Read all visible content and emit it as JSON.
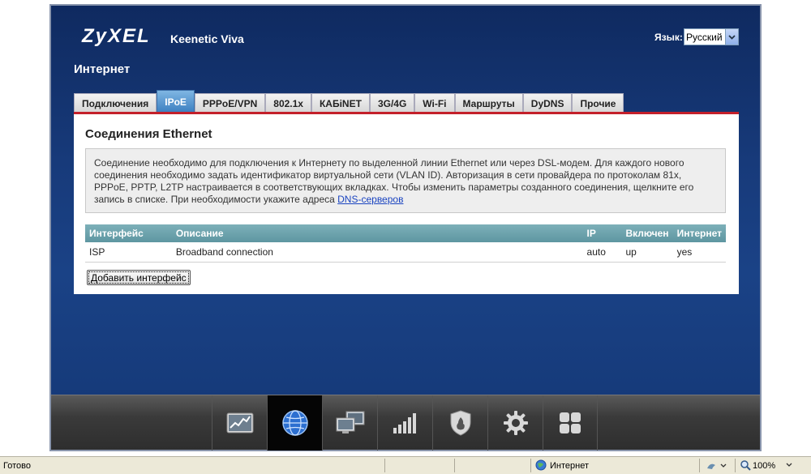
{
  "header": {
    "logo": "ZyXEL",
    "model": "Keenetic Viva",
    "language_label": "Язык:",
    "language_value": "Русский",
    "section_title": "Интернет"
  },
  "tabs": [
    {
      "label": "Подключения",
      "active": false
    },
    {
      "label": "IPoE",
      "active": true
    },
    {
      "label": "PPPoE/VPN",
      "active": false
    },
    {
      "label": "802.1x",
      "active": false
    },
    {
      "label": "КАБiNET",
      "active": false
    },
    {
      "label": "3G/4G",
      "active": false
    },
    {
      "label": "Wi-Fi",
      "active": false
    },
    {
      "label": "Маршруты",
      "active": false
    },
    {
      "label": "DyDNS",
      "active": false
    },
    {
      "label": "Прочие",
      "active": false
    }
  ],
  "panel": {
    "title": "Соединения Ethernet",
    "info_text": "Соединение необходимо для подключения к Интернету по выделенной линии Ethernet или через DSL-модем. Для каждого нового соединения необходимо задать идентификатор виртуальной сети (VLAN ID). Авторизация в сети провайдера по протоколам 81x, PPPoE, PPTP, L2TP настраивается в соответствующих вкладках. Чтобы изменить параметры созданного соединения, щелкните его запись в списке. При необходимости укажите адреса ",
    "info_link": "DNS-серверов",
    "table": {
      "headers": [
        "Интерфейс",
        "Описание",
        "IP",
        "Включен",
        "Интернет"
      ],
      "rows": [
        [
          "ISP",
          "Broadband connection",
          "auto",
          "up",
          "yes"
        ]
      ]
    },
    "add_button": "Добавить интерфейс"
  },
  "dock": {
    "items": [
      {
        "name": "monitor",
        "icon": "chart-icon",
        "active": false
      },
      {
        "name": "internet",
        "icon": "globe-icon",
        "active": true
      },
      {
        "name": "home-network",
        "icon": "computers-icon",
        "active": false
      },
      {
        "name": "wifi",
        "icon": "signal-bars-icon",
        "active": false
      },
      {
        "name": "security",
        "icon": "shield-icon",
        "active": false
      },
      {
        "name": "system",
        "icon": "gear-icon",
        "active": false
      },
      {
        "name": "applications",
        "icon": "grid-icon",
        "active": false
      }
    ]
  },
  "statusbar": {
    "status": "Готово",
    "zone": "Интернет",
    "zoom": "100%"
  }
}
